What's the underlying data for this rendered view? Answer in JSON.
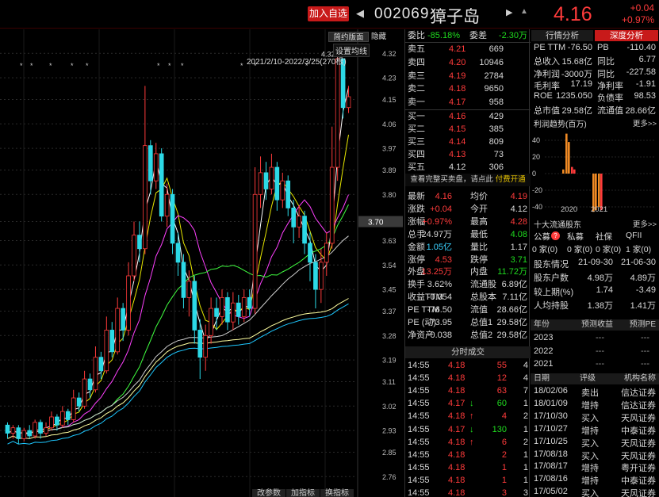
{
  "header": {
    "add_watch": "加入自选",
    "prev_glyph": "◀",
    "code": "002069",
    "name": "獐子岛",
    "next_glyph": "▶",
    "bell_glyph": "▲",
    "price": "4.16",
    "change": "+0.04",
    "change_pct": "+0.97%",
    "colors": {
      "up": "#ff3b3b",
      "down": "#1fdb1f",
      "accent": "#c81a1a"
    }
  },
  "chart": {
    "btn_simple": "简约版面",
    "btn_hide": "隐藏",
    "set_ma": "设置均线",
    "range": "2021/2/10-2022/3/25(270根)",
    "current_price_label": "3.70",
    "high_label": "4.32↗",
    "y_ticks": [
      "4.32",
      "4.23",
      "4.15",
      "4.06",
      "3.97",
      "3.89",
      "3.80",
      "3.70",
      "3.63",
      "3.54",
      "3.45",
      "3.37",
      "3.28",
      "3.19",
      "3.11",
      "3.02",
      "2.93",
      "2.85",
      "2.76"
    ],
    "bottom_tabs": [
      "改参数",
      "加指标",
      "换指标"
    ],
    "candles": [
      [
        2.95,
        2.92,
        2.96,
        2.9
      ],
      [
        2.92,
        2.94,
        2.95,
        2.9
      ],
      [
        2.94,
        2.9,
        2.95,
        2.88
      ],
      [
        2.9,
        2.93,
        2.94,
        2.89
      ],
      [
        2.93,
        2.91,
        2.95,
        2.9
      ],
      [
        2.91,
        2.96,
        2.97,
        2.9
      ],
      [
        2.96,
        2.92,
        2.97,
        2.9
      ],
      [
        2.92,
        2.94,
        2.96,
        2.91
      ],
      [
        2.94,
        2.98,
        3.0,
        2.93
      ],
      [
        2.98,
        2.95,
        2.99,
        2.93
      ],
      [
        2.95,
        3.0,
        3.02,
        2.94
      ],
      [
        3.0,
        2.97,
        3.01,
        2.95
      ],
      [
        2.97,
        3.05,
        3.08,
        2.96
      ],
      [
        3.05,
        3.02,
        3.07,
        3.0
      ],
      [
        3.02,
        3.12,
        3.15,
        3.01
      ],
      [
        3.12,
        3.08,
        3.14,
        3.05
      ],
      [
        3.08,
        3.2,
        3.24,
        3.07
      ],
      [
        3.2,
        3.15,
        3.22,
        3.12
      ],
      [
        3.15,
        3.3,
        3.35,
        3.14
      ],
      [
        3.3,
        3.22,
        3.33,
        3.2
      ],
      [
        3.22,
        3.38,
        3.42,
        3.21
      ],
      [
        3.38,
        3.3,
        3.4,
        3.26
      ],
      [
        3.3,
        3.5,
        3.55,
        3.28
      ],
      [
        3.5,
        3.65,
        3.7,
        3.48
      ],
      [
        3.65,
        3.6,
        3.7,
        3.55
      ],
      [
        3.6,
        3.98,
        4.2,
        3.58
      ],
      [
        3.98,
        3.85,
        4.0,
        3.8
      ],
      [
        3.85,
        3.95,
        3.99,
        3.82
      ],
      [
        3.95,
        3.72,
        3.97,
        3.7
      ],
      [
        3.72,
        3.8,
        3.84,
        3.68
      ],
      [
        3.8,
        3.62,
        3.82,
        3.58
      ],
      [
        3.62,
        3.55,
        3.66,
        3.5
      ],
      [
        3.55,
        3.42,
        3.58,
        3.38
      ],
      [
        3.42,
        3.48,
        3.52,
        3.35
      ],
      [
        3.48,
        3.3,
        3.5,
        3.25
      ],
      [
        3.3,
        3.2,
        3.34,
        3.12
      ],
      [
        3.2,
        3.28,
        3.32,
        3.15
      ],
      [
        3.28,
        3.38,
        3.42,
        3.25
      ],
      [
        3.38,
        3.35,
        3.42,
        3.3
      ],
      [
        3.35,
        3.42,
        3.45,
        3.32
      ],
      [
        3.42,
        3.33,
        3.44,
        3.3
      ],
      [
        3.33,
        3.4,
        3.44,
        3.3
      ],
      [
        3.4,
        3.35,
        3.43,
        3.32
      ],
      [
        3.35,
        3.42,
        3.45,
        3.33
      ],
      [
        3.42,
        3.38,
        3.45,
        3.35
      ],
      [
        3.38,
        3.8,
        3.9,
        3.36
      ],
      [
        3.8,
        3.88,
        3.94,
        3.75
      ],
      [
        3.88,
        3.82,
        3.92,
        3.78
      ],
      [
        3.82,
        3.9,
        3.95,
        3.8
      ],
      [
        3.9,
        3.78,
        3.92,
        3.74
      ],
      [
        3.78,
        3.85,
        3.88,
        3.75
      ],
      [
        3.85,
        3.75,
        3.87,
        3.72
      ],
      [
        3.75,
        3.68,
        3.78,
        3.62
      ],
      [
        3.68,
        3.72,
        3.76,
        3.64
      ],
      [
        3.72,
        3.62,
        3.74,
        3.58
      ],
      [
        3.62,
        3.55,
        3.66,
        3.48
      ],
      [
        3.55,
        3.45,
        3.58,
        3.38
      ],
      [
        3.45,
        3.55,
        3.6,
        3.4
      ],
      [
        3.55,
        3.62,
        3.66,
        3.5
      ],
      [
        3.62,
        3.9,
        4.05,
        3.6
      ],
      [
        3.9,
        4.3,
        4.32,
        3.85
      ],
      [
        4.3,
        4.12,
        4.28,
        4.08
      ],
      [
        4.12,
        4.16,
        4.2,
        4.1
      ]
    ]
  },
  "orderbook": {
    "weibi_label": "委比",
    "weibi": "-85.18%",
    "weicha_label": "委差",
    "weicha": "-2.30万",
    "asks": [
      [
        "卖五",
        "4.21",
        "669"
      ],
      [
        "卖四",
        "4.20",
        "10946"
      ],
      [
        "卖三",
        "4.19",
        "2784"
      ],
      [
        "卖二",
        "4.18",
        "9650"
      ],
      [
        "卖一",
        "4.17",
        "958"
      ]
    ],
    "bids": [
      [
        "买一",
        "4.16",
        "429"
      ],
      [
        "买二",
        "4.15",
        "385"
      ],
      [
        "买三",
        "4.14",
        "809"
      ],
      [
        "买四",
        "4.13",
        "73"
      ],
      [
        "买五",
        "4.12",
        "306"
      ]
    ],
    "notice_pre": "查看完整买卖盘，请点此 ",
    "notice_link": "付费开通"
  },
  "stats": [
    [
      "最新",
      "4.16",
      "red",
      "均价",
      "4.19",
      "red"
    ],
    [
      "涨跌",
      "+0.04",
      "red",
      "今开",
      "4.12",
      "wht"
    ],
    [
      "涨幅",
      "+0.97%",
      "red",
      "最高",
      "4.28",
      "red"
    ],
    [
      "总手",
      "24.97万",
      "wht",
      "最低",
      "4.08",
      "green"
    ],
    [
      "金额",
      "1.05亿",
      "cyan",
      "量比",
      "1.17",
      "wht"
    ],
    [
      "涨停",
      "4.53",
      "red",
      "跌停",
      "3.71",
      "green"
    ],
    [
      "外盘",
      "13.25万",
      "red",
      "内盘",
      "11.72万",
      "green"
    ],
    [
      "换手",
      "3.62%",
      "wht",
      "流通股",
      "6.89亿",
      "wht"
    ],
    [
      "收益TTM",
      "-0.054",
      "wht",
      "总股本",
      "7.11亿",
      "wht"
    ],
    [
      "PE TTM",
      "-76.50",
      "wht",
      "流值",
      "28.66亿",
      "wht"
    ],
    [
      "PE (动)",
      "-73.95",
      "wht",
      "总值1",
      "29.58亿",
      "wht"
    ],
    [
      "净资产",
      "-0.038",
      "wht",
      "总值2",
      "29.58亿",
      "wht"
    ]
  ],
  "ticks": {
    "title": "分时成交",
    "rows": [
      [
        "14:55",
        "4.18",
        "55",
        "4",
        ""
      ],
      [
        "14:55",
        "4.18",
        "12",
        "4",
        ""
      ],
      [
        "14:55",
        "4.18",
        "63",
        "7",
        ""
      ],
      [
        "14:55",
        "4.17",
        "60",
        "1",
        "↓"
      ],
      [
        "14:55",
        "4.18",
        "4",
        "2",
        "↑"
      ],
      [
        "14:55",
        "4.17",
        "130",
        "1",
        "↓"
      ],
      [
        "14:55",
        "4.18",
        "6",
        "2",
        "↑"
      ],
      [
        "14:55",
        "4.18",
        "2",
        "1",
        ""
      ],
      [
        "14:55",
        "4.18",
        "1",
        "1",
        ""
      ],
      [
        "14:55",
        "4.18",
        "1",
        "1",
        ""
      ],
      [
        "14:55",
        "4.18",
        "3",
        "3",
        ""
      ]
    ]
  },
  "analysis": {
    "tab1": "行情分析",
    "tab2": "深度分析",
    "metrics": [
      [
        "PE TTM",
        "-76.50",
        "PB",
        "-110.40"
      ],
      [
        "总收入",
        "15.68亿",
        "同比",
        "6.77"
      ],
      [
        "净利润",
        "-3000万",
        "同比",
        "-227.58"
      ],
      [
        "毛利率",
        "17.19",
        "净利率",
        "-1.91"
      ],
      [
        "ROE",
        "1235.050",
        "负债率",
        "98.53"
      ],
      [
        "总市值",
        "29.58亿",
        "流通值",
        "28.66亿"
      ]
    ],
    "profit_title": "利润趋势(百万)",
    "more": "更多>>",
    "profit_y": [
      "40",
      "20",
      "0",
      "-20",
      "-40"
    ],
    "profit_x": [
      "2020",
      "2021"
    ],
    "profit_bars": [
      {
        "v": 5,
        "c": "#f08a24"
      },
      {
        "v": 48,
        "c": "#f08a24"
      },
      {
        "v": 38,
        "c": "#f08a24"
      },
      {
        "v": 8,
        "c": "#ff3b3b"
      },
      {
        "v": 5,
        "c": "#ff3b3b"
      },
      {
        "v": -46,
        "c": "#f08a24"
      },
      {
        "v": -44,
        "c": "#f08a24"
      },
      {
        "v": -40,
        "c": "#f08a24"
      },
      {
        "v": -44,
        "c": "#ff3b3b"
      }
    ],
    "holders_title": "十大流通股东",
    "holder_cols": [
      "公募",
      "私募",
      "社保",
      "QFII"
    ],
    "fund_badge": "?",
    "holder_vals": [
      "0 家(0)",
      "0 家(0)",
      "0 家(0)",
      "1 家(0)"
    ],
    "share_rows": [
      [
        "股东情况",
        "21-09-30",
        "21-06-30"
      ],
      [
        "股东户数",
        "4.98万",
        "4.89万"
      ],
      [
        "较上期(%)",
        "1.74",
        "-3.49"
      ],
      [
        "人均持股",
        "1.38万",
        "1.41万"
      ]
    ],
    "forecast_cols": [
      "年份",
      "预测收益",
      "预测PE"
    ],
    "forecast_rows": [
      [
        "2023",
        "---",
        "---"
      ],
      [
        "2022",
        "---",
        "---"
      ],
      [
        "2021",
        "---",
        "---"
      ]
    ],
    "rating_cols": [
      "日期",
      "评级",
      "机构名称"
    ],
    "rating_rows": [
      [
        "18/02/06",
        "卖出",
        "信达证券"
      ],
      [
        "18/01/09",
        "增持",
        "信达证券"
      ],
      [
        "17/10/30",
        "买入",
        "天风证券"
      ],
      [
        "17/10/27",
        "增持",
        "中泰证券"
      ],
      [
        "17/10/25",
        "买入",
        "天风证券"
      ],
      [
        "17/08/18",
        "买入",
        "天风证券"
      ],
      [
        "17/08/17",
        "增持",
        "粤开证券"
      ],
      [
        "17/08/16",
        "增持",
        "中泰证券"
      ],
      [
        "17/05/02",
        "买入",
        "天风证券"
      ]
    ]
  }
}
